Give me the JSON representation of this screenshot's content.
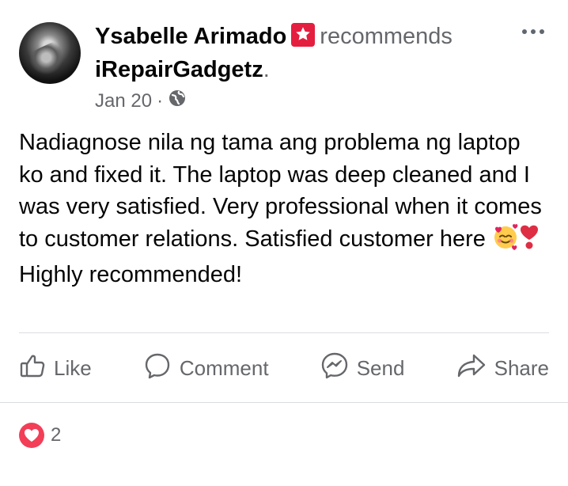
{
  "post": {
    "author_name": "Ysabelle Arimado",
    "verb": "recommends",
    "page_name": "iRepairGadgetz",
    "page_suffix": ".",
    "date": "Jan 20",
    "meta_separator": "·",
    "privacy_icon": "globe-icon",
    "more_icon": "more-options-icon",
    "badge_icon": "star-recommendation-icon",
    "text_part_1": "Nadiagnose nila ng tama ang problema ng laptop ko and fixed it. The laptop was deep cleaned and I was very satisfied. Very professional when it comes to customer relations. Satisfied customer here ",
    "emoji_1": "🥰",
    "emoji_2": "❣️",
    "text_part_2": " Highly recommended!"
  },
  "actions": [
    {
      "label": "Like",
      "icon": "thumbs-up-icon"
    },
    {
      "label": "Comment",
      "icon": "comment-bubble-icon"
    },
    {
      "label": "Send",
      "icon": "messenger-icon"
    },
    {
      "label": "Share",
      "icon": "share-arrow-icon"
    }
  ],
  "reactions": {
    "icon": "heart-reaction-icon",
    "count": "2"
  },
  "colors": {
    "primary_text": "#050505",
    "secondary_text": "#65676b",
    "badge": "#e41e3f",
    "heart": "#f33e58",
    "divider": "#dadde1"
  }
}
